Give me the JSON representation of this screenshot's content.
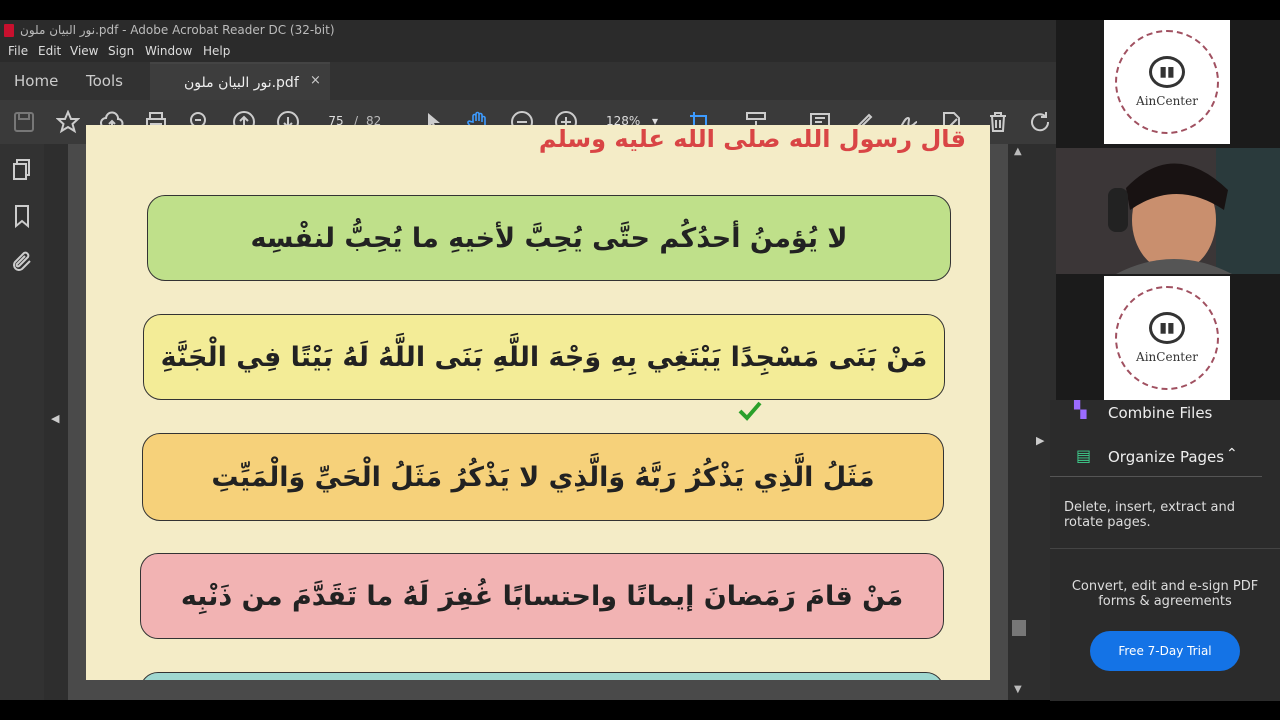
{
  "window": {
    "title": "نور البيان ملون.pdf - Adobe Acrobat Reader DC (32-bit)"
  },
  "menu": [
    "File",
    "Edit",
    "View",
    "Sign",
    "Window",
    "Help"
  ],
  "tabs": {
    "home": "Home",
    "tools": "Tools",
    "document": "نور البيان ملون.pdf",
    "close": "×"
  },
  "toolbar": {
    "page_current": "75",
    "page_sep": "/",
    "page_total": "82",
    "zoom": "128%"
  },
  "document": {
    "header": "قال رسول الله صلى الله عليه وسلم",
    "hadiths": [
      {
        "text": "لا يُؤمنُ أحدُكُم حتَّى يُحِبَّ لأخيهِ ما يُحِبُّ لنفْسِه",
        "color": "#bfe08a"
      },
      {
        "text": "مَنْ بَنَى مَسْجِدًا يَبْتَغِي بِهِ وَجْهَ اللَّهِ بَنَى اللَّهُ لَهُ بَيْتًا فِي الْجَنَّةِ",
        "color": "#f3ec97"
      },
      {
        "text": "مَثَلُ الَّذِي يَذْكُرُ رَبَّهُ وَالَّذِي لا يَذْكُرُ مَثَلُ الْحَيِّ وَالْمَيِّتِ",
        "color": "#f6d17a"
      },
      {
        "text": "مَنْ قامَ رَمَضانَ إيمانًا واحتسابًا غُفِرَ لَهُ ما تَقَدَّمَ من ذَنْبِه",
        "color": "#f2b3b3"
      },
      {
        "text": "",
        "color": "#9fd8d0"
      }
    ]
  },
  "right_panel": {
    "logo_label": "AinCenter",
    "combine_files": "Combine Files",
    "organize_pages": "Organize Pages",
    "organize_desc": "Delete, insert, extract and rotate pages.",
    "promo_text": "Convert, edit and e-sign PDF forms & agreements",
    "trial_button": "Free 7-Day Trial"
  },
  "colors": {
    "accent": "#1473e6",
    "header_red": "#d94545",
    "check_green": "#2aa02a"
  }
}
